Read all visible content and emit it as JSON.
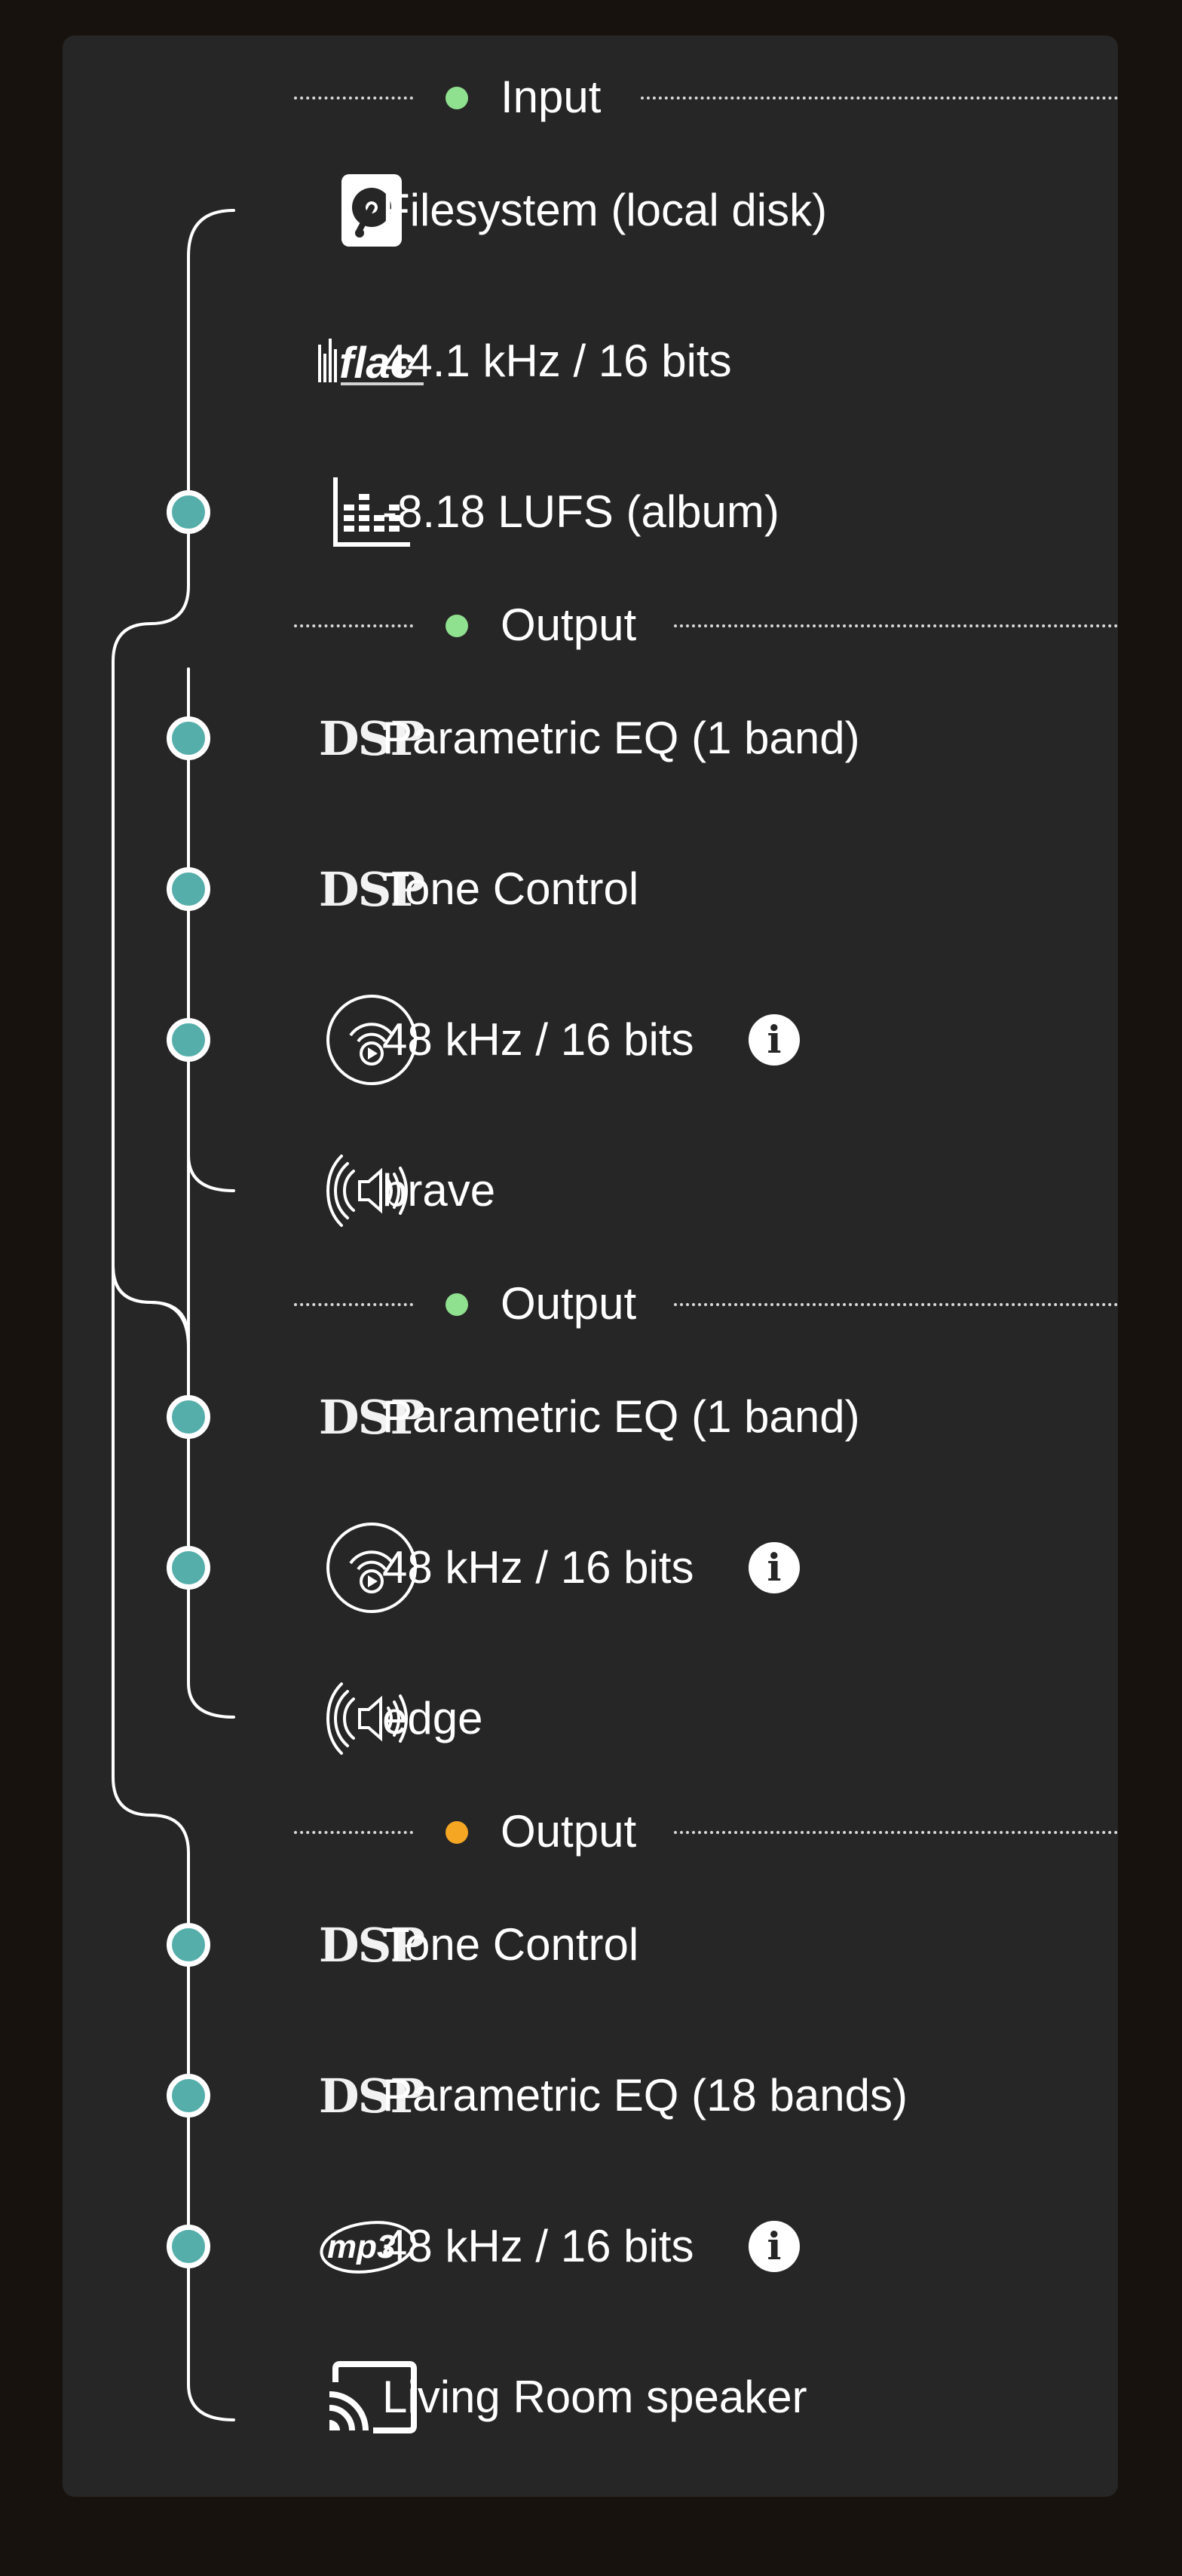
{
  "colors": {
    "background": "#17120d",
    "panel": "#262626",
    "tree_line": "#ffffff",
    "node_fill": "#55aeaa",
    "status_ok": "#8fe08f",
    "status_warning": "#f5a623"
  },
  "input": {
    "header": "Input",
    "status_color": "#8fe08f",
    "source": {
      "icon": "hard-disk-icon",
      "label": "Filesystem (local disk)"
    },
    "format": {
      "icon": "flac-icon",
      "label": "44.1 kHz / 16 bits"
    },
    "loudness": {
      "icon": "level-meter-icon",
      "label": "-8.18 LUFS (album)"
    }
  },
  "outputs": [
    {
      "header": "Output",
      "status_color": "#8fe08f",
      "steps": [
        {
          "icon": "dsp-icon",
          "icon_text": "DSP",
          "label": "Parametric EQ (1 band)"
        },
        {
          "icon": "dsp-icon",
          "icon_text": "DSP",
          "label": "Tone Control"
        },
        {
          "icon": "stream-play-icon",
          "label": "48 kHz / 16 bits",
          "info": true
        }
      ],
      "device": {
        "icon": "speaker-icon",
        "label": "brave"
      }
    },
    {
      "header": "Output",
      "status_color": "#8fe08f",
      "steps": [
        {
          "icon": "dsp-icon",
          "icon_text": "DSP",
          "label": "Parametric EQ (1 band)"
        },
        {
          "icon": "stream-play-icon",
          "label": "48 kHz / 16 bits",
          "info": true
        }
      ],
      "device": {
        "icon": "speaker-icon",
        "label": "edge"
      }
    },
    {
      "header": "Output",
      "status_color": "#f5a623",
      "steps": [
        {
          "icon": "dsp-icon",
          "icon_text": "DSP",
          "label": "Tone Control"
        },
        {
          "icon": "dsp-icon",
          "icon_text": "DSP",
          "label": "Parametric EQ (18 bands)"
        },
        {
          "icon": "mp3-icon",
          "icon_text": "mp3",
          "label": "48 kHz / 16 bits",
          "info": true
        }
      ],
      "device": {
        "icon": "cast-icon",
        "label": "Living Room speaker"
      }
    }
  ],
  "info_icon_glyph": "i"
}
